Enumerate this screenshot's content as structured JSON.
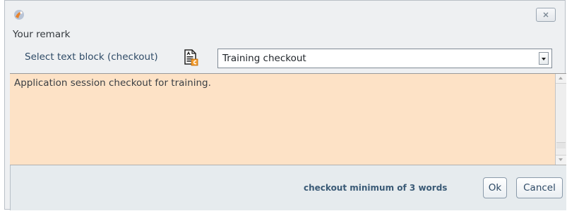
{
  "dialog": {
    "remark_label": "Your remark",
    "select_label": "Select text block (checkout)",
    "dropdown_value": "Training checkout",
    "remark_text": "Application session checkout for training.",
    "hint": "checkout minimum of 3 words",
    "ok_label": "Ok",
    "cancel_label": "Cancel"
  },
  "icons": {
    "app": "app-logo-icon",
    "close": "close-icon",
    "text_block": "text-block-icon",
    "dropdown": "chevron-down-icon"
  },
  "colors": {
    "remark_background": "#fde2c6",
    "panel_background": "#eef0f2",
    "label_blue": "#2e4a66"
  }
}
